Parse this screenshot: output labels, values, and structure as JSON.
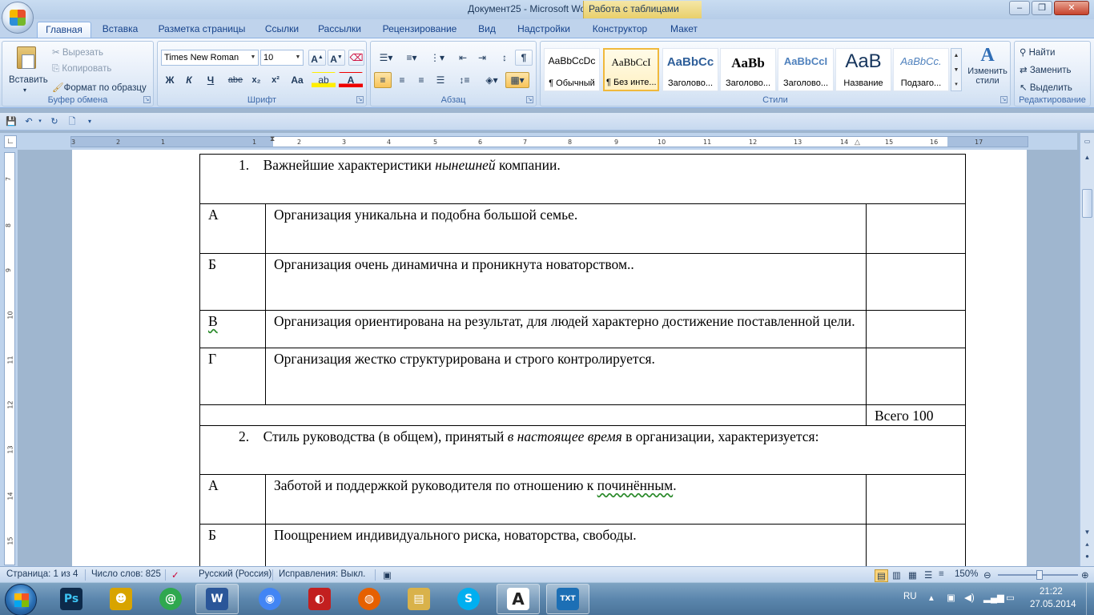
{
  "window": {
    "title": "Документ25 - Microsoft Word",
    "context_tab": "Работа с таблицами",
    "minimize": "–",
    "maximize": "❐",
    "close": "✕"
  },
  "tabs": [
    {
      "label": "Главная",
      "active": true
    },
    {
      "label": "Вставка"
    },
    {
      "label": "Разметка страницы"
    },
    {
      "label": "Ссылки"
    },
    {
      "label": "Рассылки"
    },
    {
      "label": "Рецензирование"
    },
    {
      "label": "Вид"
    },
    {
      "label": "Надстройки"
    },
    {
      "label": "Конструктор"
    },
    {
      "label": "Макет"
    }
  ],
  "ribbon": {
    "clipboard": {
      "paste": "Вставить",
      "cut": "Вырезать",
      "copy": "Копировать",
      "format_painter": "Формат по образцу",
      "label": "Буфер обмена"
    },
    "font": {
      "family": "Times New Roman",
      "size": "10",
      "bold": "Ж",
      "italic": "К",
      "underline": "Ч",
      "strike": "abe",
      "subscript": "x₂",
      "superscript": "x²",
      "change_case": "Aa",
      "label": "Шрифт"
    },
    "paragraph": {
      "label": "Абзац"
    },
    "styles": {
      "items": [
        {
          "sample": "AaBbCcDc",
          "name": "¶ Обычный"
        },
        {
          "sample": "AaBbCcI",
          "name": "¶ Без инте..."
        },
        {
          "sample": "AaBbCc",
          "name": "Заголово..."
        },
        {
          "sample": "AaBb",
          "name": "Заголово..."
        },
        {
          "sample": "AaBbCcI",
          "name": "Заголово..."
        },
        {
          "sample": "AaB",
          "name": "Название"
        },
        {
          "sample": "AaBbCc.",
          "name": "Подзаго..."
        }
      ],
      "change_styles": "Изменить стили",
      "label": "Стили"
    },
    "editing": {
      "find": "Найти",
      "replace": "Заменить",
      "select": "Выделить",
      "label": "Редактирование"
    }
  },
  "ruler": {
    "h_ticks": [
      "3",
      "2",
      "1",
      "1",
      "2",
      "3",
      "4",
      "5",
      "6",
      "7",
      "8",
      "9",
      "10",
      "11",
      "12",
      "13",
      "14",
      "15",
      "16",
      "17"
    ],
    "v_ticks": [
      "7",
      "8",
      "9",
      "10",
      "11",
      "12",
      "13",
      "14",
      "15"
    ]
  },
  "document": {
    "q1_num": "1.",
    "q1_pre": "Важнейшие характеристики ",
    "q1_em": "нынешней",
    "q1_post": " компании.",
    "q1_rows": [
      {
        "letter": "А",
        "text": "Организация уникальна и подобна большой семье."
      },
      {
        "letter": "Б",
        "text": "Организация очень динамична и проникнута новаторством.."
      },
      {
        "letter": "В",
        "text": "Организация ориентирована на результат, для людей характерно достижение поставленной цели."
      },
      {
        "letter": "Г",
        "text": "Организация жестко структурирована и строго контролируется."
      }
    ],
    "total": "Всего 100",
    "q2_num": "2.",
    "q2_pre": "Стиль руководства (в общем), принятый ",
    "q2_em": "в настоящее время",
    "q2_post": " в организации, характеризуется:",
    "q2_rows": [
      {
        "letter": "А",
        "text_pre": "Заботой и поддержкой руководителя по отношению к ",
        "text_wavy": "починённым",
        "text_post": "."
      },
      {
        "letter": "Б",
        "text": "Поощрением индивидуального риска, новаторства, свободы."
      }
    ]
  },
  "status": {
    "page": "Страница: 1 из 4",
    "words": "Число слов: 825",
    "lang": "Русский (Россия)",
    "track": "Исправления: Выкл.",
    "zoom": "150%"
  },
  "taskbar": {
    "apps": [
      {
        "icon": "photoshop-icon",
        "label": "Ps",
        "color": "#0d2a4a"
      },
      {
        "icon": "agent-icon",
        "label": "☻",
        "color": "#d8a400"
      },
      {
        "icon": "mail-icon",
        "label": "@",
        "color": "#2fa84f"
      },
      {
        "icon": "word-icon",
        "label": "W",
        "color": "#2a5699"
      },
      {
        "icon": "chrome-icon",
        "label": "◉",
        "color": "#4285f4"
      },
      {
        "icon": "screencast-icon",
        "label": "◐",
        "color": "#c21f1f"
      },
      {
        "icon": "firefox-icon",
        "label": "◍",
        "color": "#e66000"
      },
      {
        "icon": "explorer-icon",
        "label": "▤",
        "color": "#d9b24a"
      },
      {
        "icon": "skype-icon",
        "label": "S",
        "color": "#00aff0"
      },
      {
        "icon": "font-icon",
        "label": "A",
        "color": "#222"
      },
      {
        "icon": "txt-icon",
        "label": "TXT",
        "color": "#1c6fb5"
      }
    ],
    "lang": "RU",
    "time": "21:22",
    "date": "27.05.2014"
  }
}
